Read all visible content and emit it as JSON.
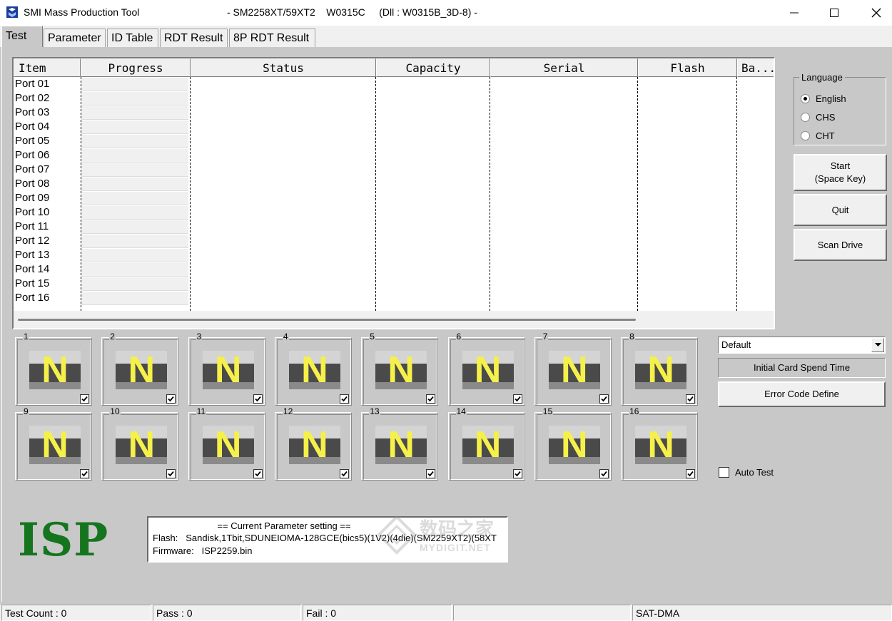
{
  "window": {
    "app_title": "SMI Mass Production Tool",
    "chip_info": "- SM2258XT/59XT2    W0315C     (Dll : W0315B_3D-8) -"
  },
  "tabs": [
    "Test",
    "Parameter",
    "ID Table",
    "RDT Result",
    "8P RDT Result"
  ],
  "list": {
    "columns": [
      "Item",
      "Progress",
      "Status",
      "Capacity",
      "Serial",
      "Flash",
      "Ba..."
    ],
    "ports": [
      "Port 01",
      "Port 02",
      "Port 03",
      "Port 04",
      "Port 05",
      "Port 06",
      "Port 07",
      "Port 08",
      "Port 09",
      "Port 10",
      "Port 11",
      "Port 12",
      "Port 13",
      "Port 14",
      "Port 15",
      "Port 16"
    ]
  },
  "language": {
    "legend": "Language",
    "options": [
      "English",
      "CHS",
      "CHT"
    ],
    "selected": "English"
  },
  "buttons": {
    "start_line1": "Start",
    "start_line2": "(Space Key)",
    "quit": "Quit",
    "scan": "Scan Drive",
    "error_code": "Error Code Define"
  },
  "port_boxes": {
    "numbers": [
      "1",
      "2",
      "3",
      "4",
      "5",
      "6",
      "7",
      "8",
      "9",
      "10",
      "11",
      "12",
      "13",
      "14",
      "15",
      "16"
    ],
    "letter": "N",
    "checked": true
  },
  "combo": {
    "value": "Default"
  },
  "initial_card_label": "Initial Card Spend Time",
  "auto_test_label": "Auto Test",
  "mode_label": "ISP",
  "params": {
    "title": "== Current Parameter setting ==",
    "flash_label": "Flash:",
    "flash_value": "Sandisk,1Tbit,SDUNEIOMA-128GCE(bics5)(1V2)(4die)(SM2259XT2)(58XT",
    "fw_label": "Firmware:",
    "fw_value": "ISP2259.bin"
  },
  "watermark": {
    "cn": "数码之家",
    "en": "MYDIGIT.NET"
  },
  "status": {
    "test_count": "Test Count : 0",
    "pass": "Pass : 0",
    "fail": "Fail : 0",
    "empty": "",
    "mode": "SAT-DMA"
  },
  "colors": {
    "isp_green": "#14751e",
    "n_yellow": "#f5f04a",
    "panel_gray": "#c8c8c8"
  }
}
